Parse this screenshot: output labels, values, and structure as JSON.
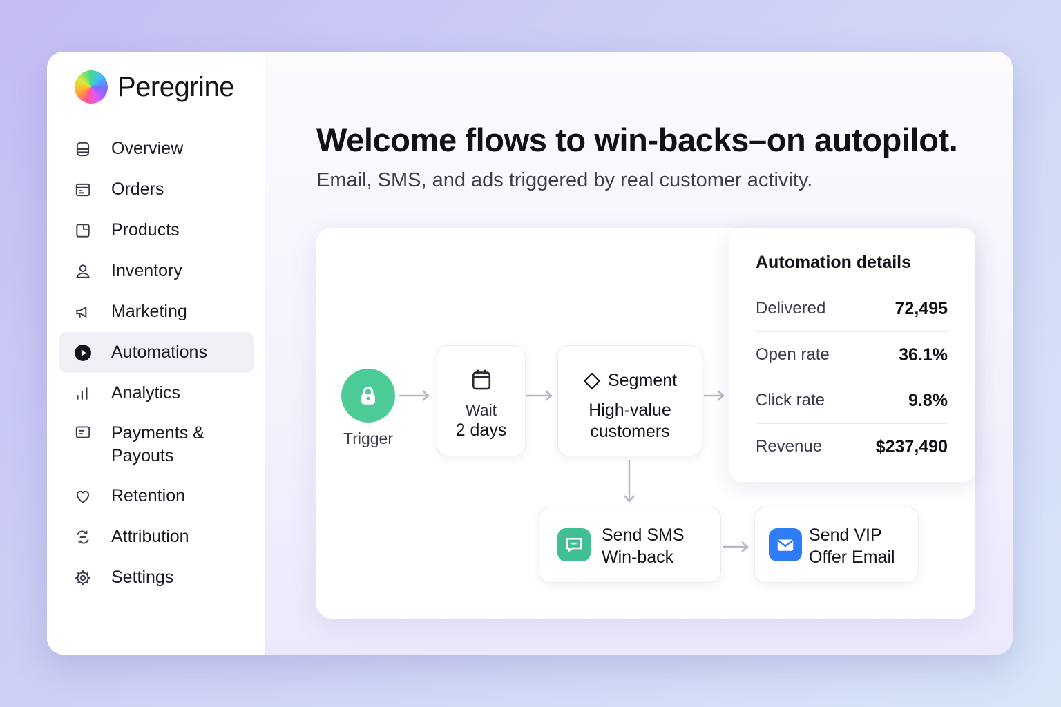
{
  "app": {
    "name": "Peregrine"
  },
  "sidebar": {
    "items": [
      {
        "label": "Overview",
        "icon": "database-icon"
      },
      {
        "label": "Orders",
        "icon": "receipt-icon"
      },
      {
        "label": "Products",
        "icon": "product-icon"
      },
      {
        "label": "Inventory",
        "icon": "user-icon"
      },
      {
        "label": "Marketing",
        "icon": "megaphone-icon"
      },
      {
        "label": "Automations",
        "icon": "play-circle-icon",
        "active": true
      },
      {
        "label": "Analytics",
        "icon": "bar-chart-icon"
      },
      {
        "label": "Payments & Payouts",
        "icon": "wallet-icon"
      },
      {
        "label": "Retention",
        "icon": "heart-icon"
      },
      {
        "label": "Attribution",
        "icon": "attribution-icon"
      },
      {
        "label": "Settings",
        "icon": "gear-icon"
      }
    ]
  },
  "hero": {
    "title": "Welcome flows to win-backs–on autopilot.",
    "subtitle": "Email, SMS, and ads triggered by real customer activity."
  },
  "flow": {
    "trigger": {
      "label": "Trigger",
      "icon": "lock-icon",
      "color": "#4ccb96"
    },
    "wait": {
      "label": "Wait",
      "value": "2 days",
      "icon": "calendar-icon"
    },
    "segment": {
      "title": "Segment",
      "line1": "High-value",
      "line2": "customers",
      "icon": "diamond-icon"
    },
    "sms": {
      "line1": "Send SMS",
      "line2": "Win-back",
      "icon": "chat-icon",
      "color": "#3fbf93"
    },
    "email": {
      "line1": "Send VIP",
      "line2": "Offer Email",
      "icon": "mail-icon",
      "color": "#2e7cf6"
    }
  },
  "details": {
    "title": "Automation details",
    "metrics": [
      {
        "label": "Delivered",
        "value": "72,495"
      },
      {
        "label": "Open rate",
        "value": "36.1%"
      },
      {
        "label": "Click rate",
        "value": "9.8%"
      },
      {
        "label": "Revenue",
        "value": "$237,490"
      }
    ]
  }
}
